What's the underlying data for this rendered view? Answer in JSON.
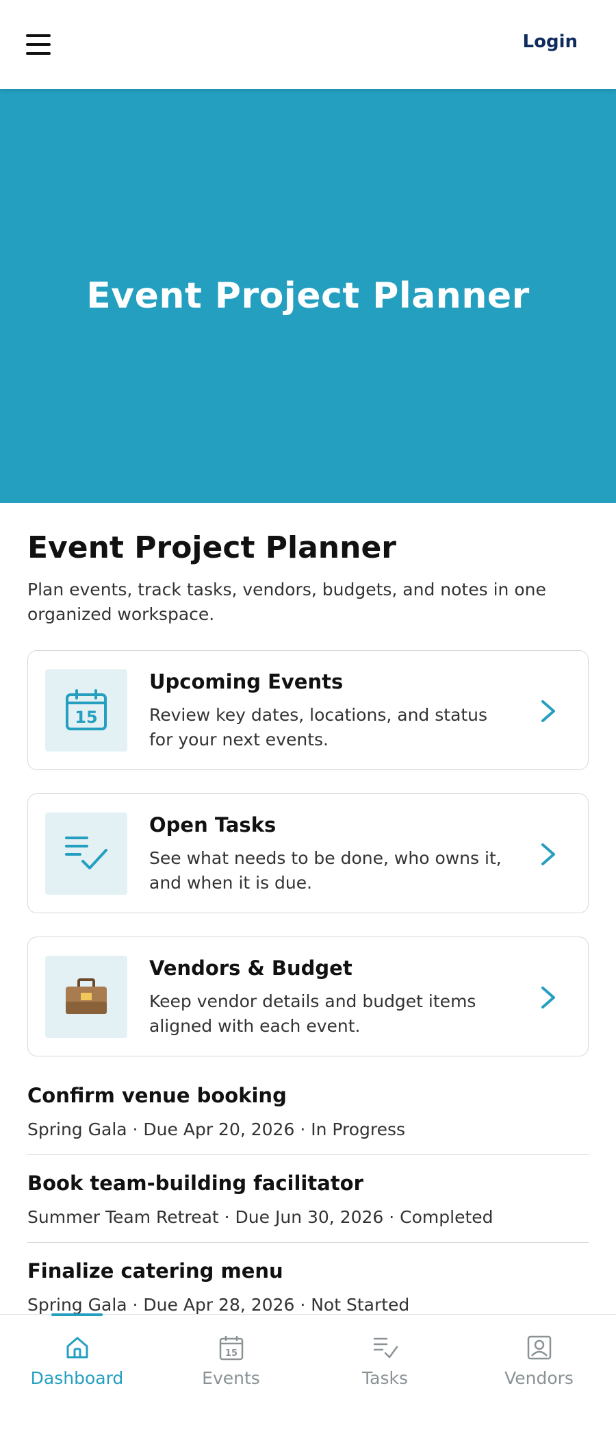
{
  "header": {
    "login_label": "Login"
  },
  "hero": {
    "title": "Event Project Planner"
  },
  "main": {
    "title": "Event Project Planner",
    "subtitle": "Plan events, track tasks, vendors, budgets, and notes in one organized workspace."
  },
  "cards": [
    {
      "title": "Upcoming Events",
      "description": "Review key dates, locations, and status for your next events.",
      "icon": "calendar-icon",
      "icon_text": "15"
    },
    {
      "title": "Open Tasks",
      "description": "See what needs to be done, who owns it, and when it is due.",
      "icon": "checklist-icon"
    },
    {
      "title": "Vendors & Budget",
      "description": "Keep vendor details and budget items aligned with each event.",
      "icon": "briefcase-icon"
    }
  ],
  "tasks": [
    {
      "title": "Confirm venue booking",
      "meta": "Spring Gala · Due Apr 20, 2026 · In Progress"
    },
    {
      "title": "Book team-building facilitator",
      "meta": "Summer Team Retreat · Due Jun 30, 2026 · Completed"
    },
    {
      "title": "Finalize catering menu",
      "meta": "Spring Gala · Due Apr 28, 2026 · Not Started"
    }
  ],
  "bottom_nav": {
    "items": [
      {
        "label": "Dashboard",
        "icon": "home-icon",
        "active": true
      },
      {
        "label": "Events",
        "icon": "calendar-icon",
        "icon_text": "15"
      },
      {
        "label": "Tasks",
        "icon": "checklist-icon"
      },
      {
        "label": "Vendors",
        "icon": "vendor-profile-icon"
      }
    ]
  },
  "colors": {
    "accent": "#249fc0",
    "login": "#0f2a5c",
    "inactive_nav": "#8a9296",
    "icon_tile": "#e3f1f5"
  }
}
